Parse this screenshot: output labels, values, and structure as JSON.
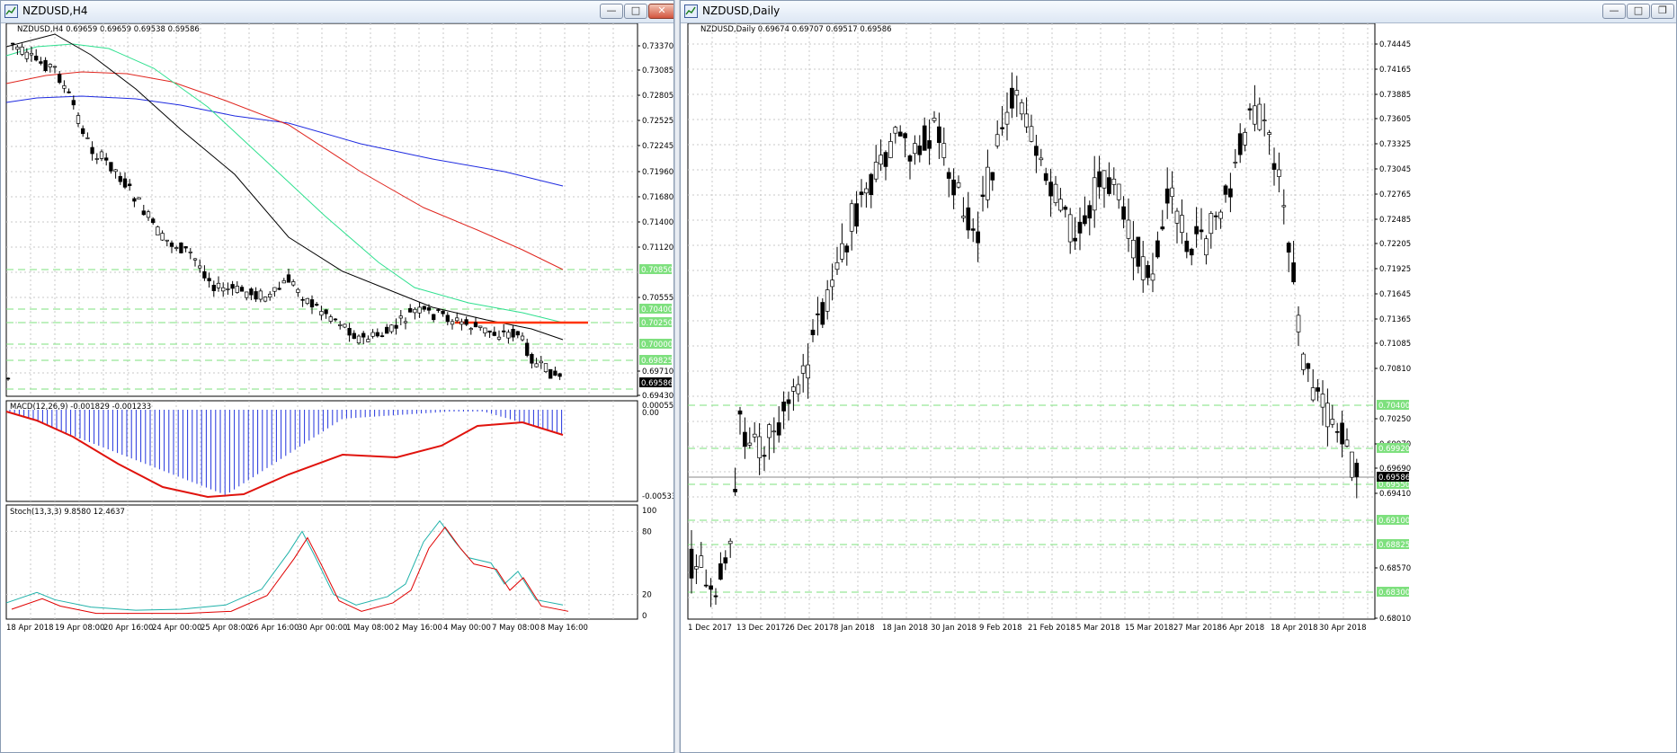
{
  "left": {
    "title": "NZDUSD,H4",
    "info": "NZDUSD,H4  0.69659 0.69659 0.69538 0.69586",
    "price_labels": [
      "0.73370",
      "0.73085",
      "0.72805",
      "0.72525",
      "0.72245",
      "0.71960",
      "0.71680",
      "0.71400",
      "0.71120",
      "0.70555",
      "0.69710",
      "0.69430"
    ],
    "level_labels": [
      "0.70850",
      "0.70400",
      "0.70250",
      "0.70000",
      "0.69825"
    ],
    "current_price": "0.69586",
    "macd_info": "MACD(12,26,9) -0.001829 -0.001233",
    "macd_labels": [
      "0.000552",
      "0.00",
      "-0.00533"
    ],
    "stoch_info": "Stoch(13,3,3) 9.8580 12.4637",
    "stoch_labels": [
      "100",
      "80",
      "20",
      "0"
    ],
    "time_labels": [
      "18 Apr 2018",
      "19 Apr 08:00",
      "20 Apr 16:00",
      "24 Apr 00:00",
      "25 Apr 08:00",
      "26 Apr 16:00",
      "30 Apr 00:00",
      "1 May 08:00",
      "2 May 16:00",
      "4 May 00:00",
      "7 May 08:00",
      "8 May 16:00"
    ]
  },
  "right": {
    "title": "NZDUSD,Daily",
    "info": "NZDUSD,Daily  0.69674 0.69707 0.69517 0.69586",
    "price_labels": [
      "0.74445",
      "0.74165",
      "0.73885",
      "0.73605",
      "0.73325",
      "0.73045",
      "0.72765",
      "0.72485",
      "0.72205",
      "0.71925",
      "0.71645",
      "0.71365",
      "0.71085",
      "0.70810",
      "0.70250",
      "0.69970",
      "0.69690",
      "0.69410",
      "0.68570",
      "0.68010"
    ],
    "level_labels": [
      "0.70400",
      "0.69920",
      "0.69550",
      "0.69100",
      "0.68825",
      "0.68300"
    ],
    "current_price": "0.69586",
    "time_labels": [
      "1 Dec 2017",
      "13 Dec 2017",
      "26 Dec 2017",
      "8 Jan 2018",
      "18 Jan 2018",
      "30 Jan 2018",
      "9 Feb 2018",
      "21 Feb 2018",
      "5 Mar 2018",
      "15 Mar 2018",
      "27 Mar 2018",
      "6 Apr 2018",
      "18 Apr 2018",
      "30 Apr 2018"
    ]
  },
  "colors": {
    "bull": "#ffffff",
    "bear": "#000000",
    "level_fill": "#7ee07e",
    "ma_blue": "#1f2be0",
    "ma_red": "#e0261f",
    "ma_green": "#2fe08f",
    "macd_hist": "#2233dd",
    "macd_signal": "#e0130d",
    "stoch_main": "#20b2aa",
    "stoch_signal": "#e00000",
    "resistance": "#ff3300"
  }
}
